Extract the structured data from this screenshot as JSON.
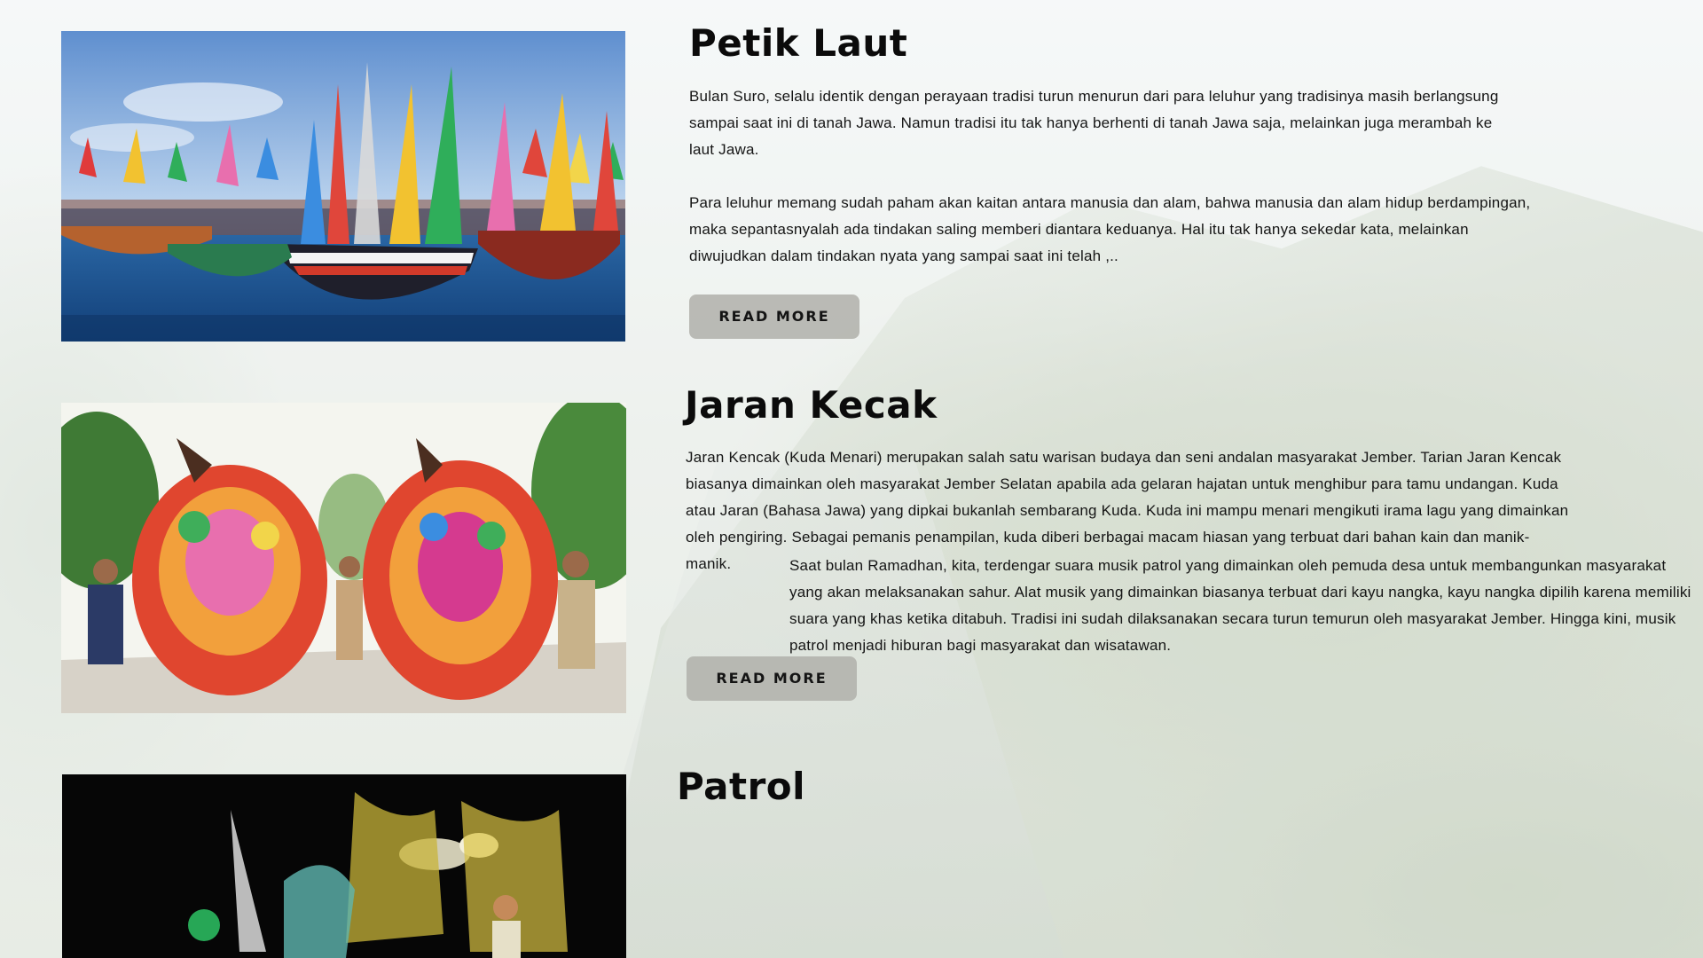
{
  "sections": [
    {
      "title": "Petik Laut",
      "paragraphs": [
        "Bulan Suro, selalu identik dengan perayaan tradisi turun menurun dari para leluhur yang tradisinya masih berlangsung sampai saat ini di tanah Jawa. Namun tradisi itu tak hanya berhenti di tanah Jawa saja, melainkan juga merambah ke laut Jawa.",
        "Para leluhur memang sudah paham akan kaitan antara manusia dan alam, bahwa manusia dan alam hidup berdampingan, maka sepantasnyalah ada tindakan saling memberi diantara keduanya. Hal itu tak hanya sekedar kata, melainkan diwujudkan dalam tindakan nyata yang sampai saat ini telah ,.."
      ],
      "button_label": "READ MORE",
      "image": "decorated-fishing-boats-photo"
    },
    {
      "title": "Jaran Kecak",
      "paragraphs": [
        "Jaran Kencak (Kuda Menari) merupakan salah satu warisan budaya dan seni andalan masyarakat Jember. Tarian Jaran Kencak biasanya dimainkan oleh masyarakat Jember Selatan apabila ada gelaran hajatan untuk menghibur para tamu undangan. Kuda atau Jaran (Bahasa Jawa) yang dipkai bukanlah sembarang Kuda. Kuda ini mampu menari mengikuti irama lagu yang dimainkan oleh pengiring. Sebagai pemanis penampilan, kuda diberi berbagai macam hiasan yang terbuat dari bahan kain dan manik-manik."
      ],
      "button_label": "READ MORE",
      "image": "dancing-horses-costume-photo"
    },
    {
      "title": "Patrol",
      "paragraphs": [
        "Saat bulan Ramadhan, kita, terdengar suara musik patrol yang dimainkan oleh pemuda desa untuk membangunkan masyarakat yang akan melaksanakan sahur. Alat musik yang dimainkan biasanya terbuat dari kayu nangka, kayu nangka dipilih karena memiliki suara yang khas ketika ditabuh. Tradisi ini sudah dilaksanakan secara turun temurun oleh masyarakat Jember. Hingga kini, musik patrol menjadi hiburan bagi masyarakat dan wisatawan."
      ],
      "image": "night-patrol-parade-photo"
    }
  ],
  "colors": {
    "title": "#0b0b0b",
    "body_text": "#151515",
    "button_bg": "#b2b2ac"
  }
}
